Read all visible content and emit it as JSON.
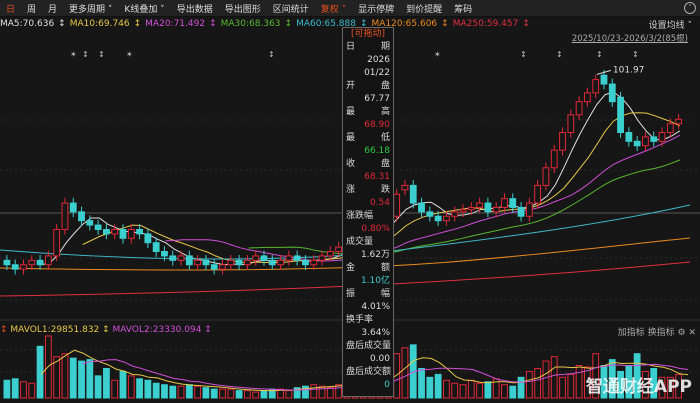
{
  "toolbar": {
    "items": [
      "日",
      "周",
      "月",
      "更多周期 ˅",
      "K线叠加 ˅",
      "导出数据",
      "导出图形",
      "区间统计",
      "复权 ˅",
      "显示停牌",
      "到价提醒",
      "筹码"
    ]
  },
  "ma": [
    {
      "label": "MA5:70.636",
      "color": "#e0e0e0"
    },
    {
      "label": "MA10:69.746",
      "color": "#e6c84a"
    },
    {
      "label": "MA20:71.492",
      "color": "#d050d8"
    },
    {
      "label": "MA30:68.363",
      "color": "#58b830"
    },
    {
      "label": "MA60:65.888",
      "color": "#40b8c8"
    },
    {
      "label": "MA120:65.606",
      "color": "#e88a20"
    },
    {
      "label": "MA250:59.457",
      "color": "#e03040"
    }
  ],
  "settings_label": "设置均线 ˅",
  "range_label": "2025/10/23-2026/3/2(85根)",
  "max_label": "101.97",
  "tooltip": {
    "header": "[可拖动]",
    "date_label": [
      "日",
      "期"
    ],
    "date_year": "2026",
    "date_md": "01/22",
    "open_label": [
      "开",
      "盘"
    ],
    "open": "67.77",
    "high_label": [
      "最",
      "高"
    ],
    "high": "68.90",
    "low_label": [
      "最",
      "低"
    ],
    "low": "66.18",
    "close_label": [
      "收",
      "盘"
    ],
    "close": "68.31",
    "change_label": [
      "涨",
      "跌"
    ],
    "change": "0.54",
    "pct_label": "涨跌幅",
    "pct": "0.80%",
    "vol_label": "成交量",
    "vol": "1.62万",
    "amt_label": [
      "金",
      "额"
    ],
    "amt": "1.10亿",
    "amp_label": [
      "振",
      "幅"
    ],
    "amp": "4.01%",
    "turn_label": "换手率",
    "turn": "3.64%",
    "ahvol_label": "盘后成交量",
    "ahvol": "0.00",
    "ahamt_label": "盘后成交额",
    "ahamt": "0"
  },
  "colors": {
    "up": "#e02838",
    "down": "#3ccfcf",
    "green": "#2ec840",
    "orange": "#e8501e"
  },
  "volume": {
    "mavol1": "MAVOL1:29851.832",
    "mavol2": "MAVOL2:23330.094",
    "buttons": [
      "加指标",
      "换指标"
    ]
  },
  "watermark": "智通财经APP",
  "chart_data": {
    "type": "candlestick",
    "open": [
      59,
      58,
      57,
      58,
      59,
      58,
      60,
      66,
      72,
      70,
      68,
      67,
      66,
      65,
      66,
      64,
      66,
      65,
      63,
      61,
      60,
      59,
      60,
      58,
      59,
      58,
      57,
      58,
      59,
      58,
      59,
      60,
      59,
      58,
      59,
      60,
      59,
      58,
      59,
      60,
      61,
      62,
      63,
      64,
      66,
      67,
      67.77,
      69,
      75,
      76,
      72,
      70,
      69,
      68,
      69,
      70,
      70.5,
      71,
      72,
      70,
      71,
      73,
      71,
      69,
      72,
      76,
      80,
      84,
      88,
      92,
      95,
      97,
      101,
      99,
      96,
      88,
      86,
      85,
      87,
      86,
      88,
      90
    ],
    "close": [
      58,
      57,
      58,
      59,
      58,
      60,
      66,
      72,
      70,
      68,
      67,
      66,
      65,
      66,
      64,
      66,
      65,
      63,
      61,
      60,
      59,
      60,
      58,
      59,
      58,
      57,
      58,
      59,
      58,
      59,
      60,
      59,
      58,
      59,
      60,
      59,
      58,
      59,
      60,
      61,
      62,
      63,
      64,
      66,
      67,
      67.6,
      68.31,
      74,
      76,
      72,
      70,
      69,
      68,
      69,
      70,
      70.5,
      71,
      72,
      70,
      71,
      73,
      71,
      69,
      72,
      76,
      80,
      84,
      88,
      92,
      95,
      97,
      100,
      99,
      95,
      88,
      86,
      85,
      87,
      86,
      88,
      90,
      91
    ],
    "volume": [
      12,
      13,
      11,
      10,
      35,
      42,
      28,
      30,
      27,
      25,
      26,
      15,
      20,
      12,
      18,
      15,
      13,
      12,
      10,
      9,
      8,
      8,
      9,
      8,
      7,
      6,
      6,
      6,
      5,
      5,
      4,
      5,
      6,
      6,
      5,
      7,
      8,
      9,
      8,
      7,
      9,
      10,
      10,
      11,
      12,
      12,
      16,
      30,
      34,
      36,
      20,
      14,
      16,
      12,
      10,
      9,
      12,
      10,
      11,
      13,
      9,
      8,
      14,
      18,
      20,
      25,
      28,
      14,
      16,
      22,
      21,
      30,
      22,
      26,
      18,
      22,
      30,
      18,
      20,
      14,
      14,
      16,
      15
    ],
    "ylim": [
      50,
      104
    ]
  }
}
